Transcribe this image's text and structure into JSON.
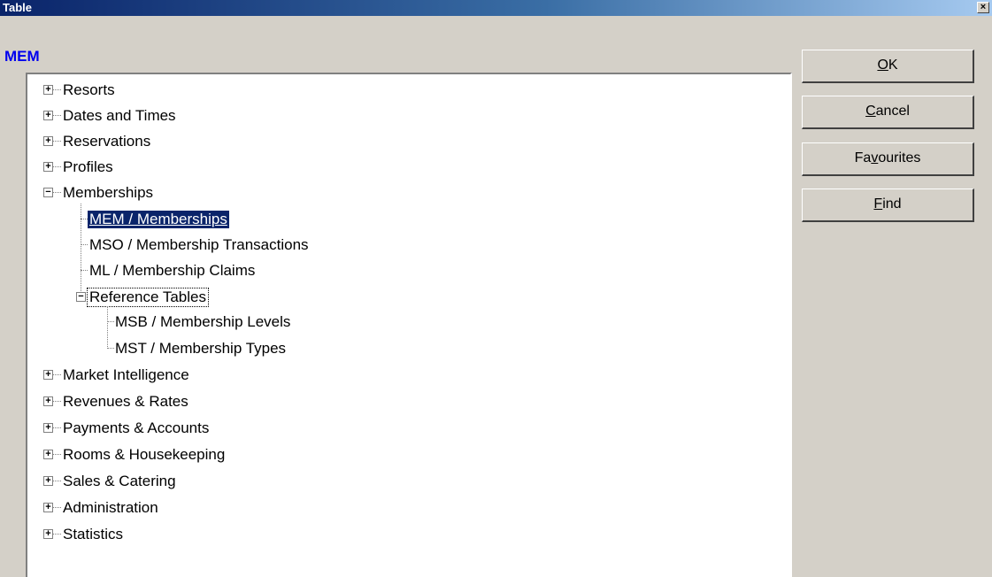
{
  "window": {
    "title": "Table"
  },
  "header": {
    "label": "MEM"
  },
  "buttons": {
    "ok": {
      "prefix": "",
      "mnemonic": "O",
      "suffix": "K"
    },
    "cancel": {
      "prefix": "",
      "mnemonic": "C",
      "suffix": "ancel"
    },
    "favourites": {
      "prefix": "Fa",
      "mnemonic": "v",
      "suffix": "ourites"
    },
    "find": {
      "prefix": "",
      "mnemonic": "F",
      "suffix": "ind"
    }
  },
  "tree": {
    "resorts": "Resorts",
    "dates_times": "Dates and Times",
    "reservations": "Reservations",
    "profiles": "Profiles",
    "memberships": "Memberships",
    "mem": "MEM / Memberships",
    "mso": "MSO / Membership Transactions",
    "ml": "ML / Membership Claims",
    "reference_tables": "Reference Tables",
    "msb": "MSB / Membership Levels",
    "mst": "MST / Membership Types",
    "market_intelligence": "Market Intelligence",
    "revenues_rates": "Revenues & Rates",
    "payments_accounts": "Payments & Accounts",
    "rooms_housekeeping": "Rooms & Housekeeping",
    "sales_catering": "Sales & Catering",
    "administration": "Administration",
    "statistics": "Statistics"
  },
  "icons": {
    "expand": "plus-box-icon",
    "collapse": "minus-box-icon",
    "close": "close-icon"
  },
  "colors": {
    "selection": "#0a246a",
    "header_label": "#0000ee",
    "titlebar": "#0a246a"
  }
}
